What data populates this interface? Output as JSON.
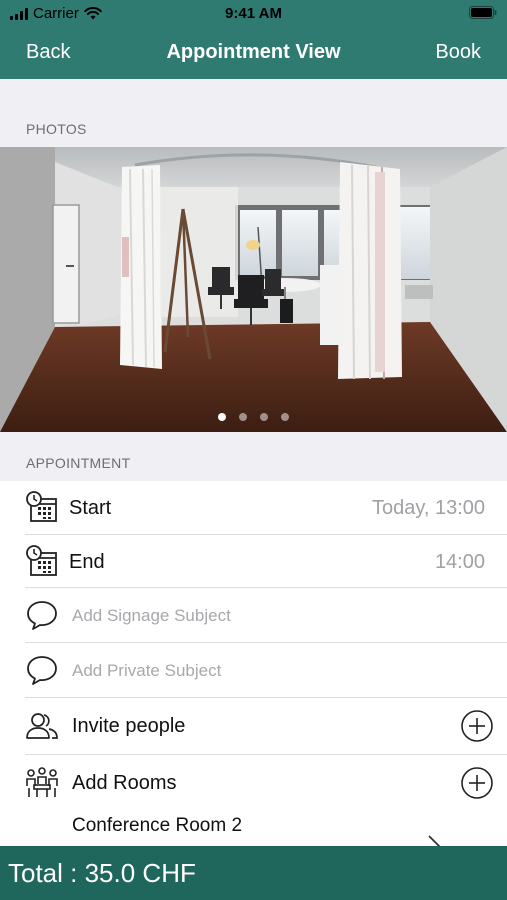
{
  "status_bar": {
    "carrier": "Carrier",
    "time": "9:41 AM"
  },
  "nav": {
    "back_label": "Back",
    "title": "Appointment View",
    "book_label": "Book"
  },
  "photos": {
    "header": "PHOTOS",
    "page_count": 4,
    "current_page": 1
  },
  "appointment": {
    "header": "APPOINTMENT",
    "start_label": "Start",
    "start_value": "Today, 13:00",
    "end_label": "End",
    "end_value": "14:00",
    "signage_placeholder": "Add Signage Subject",
    "private_placeholder": "Add Private Subject",
    "invite_label": "Invite people",
    "rooms_label": "Add Rooms",
    "room_name": "Conference Room 2"
  },
  "footer": {
    "total": "Total : 35.0 CHF"
  },
  "colors": {
    "nav": "#2f7b72",
    "footer": "#1f665c",
    "background": "#efeff4"
  }
}
